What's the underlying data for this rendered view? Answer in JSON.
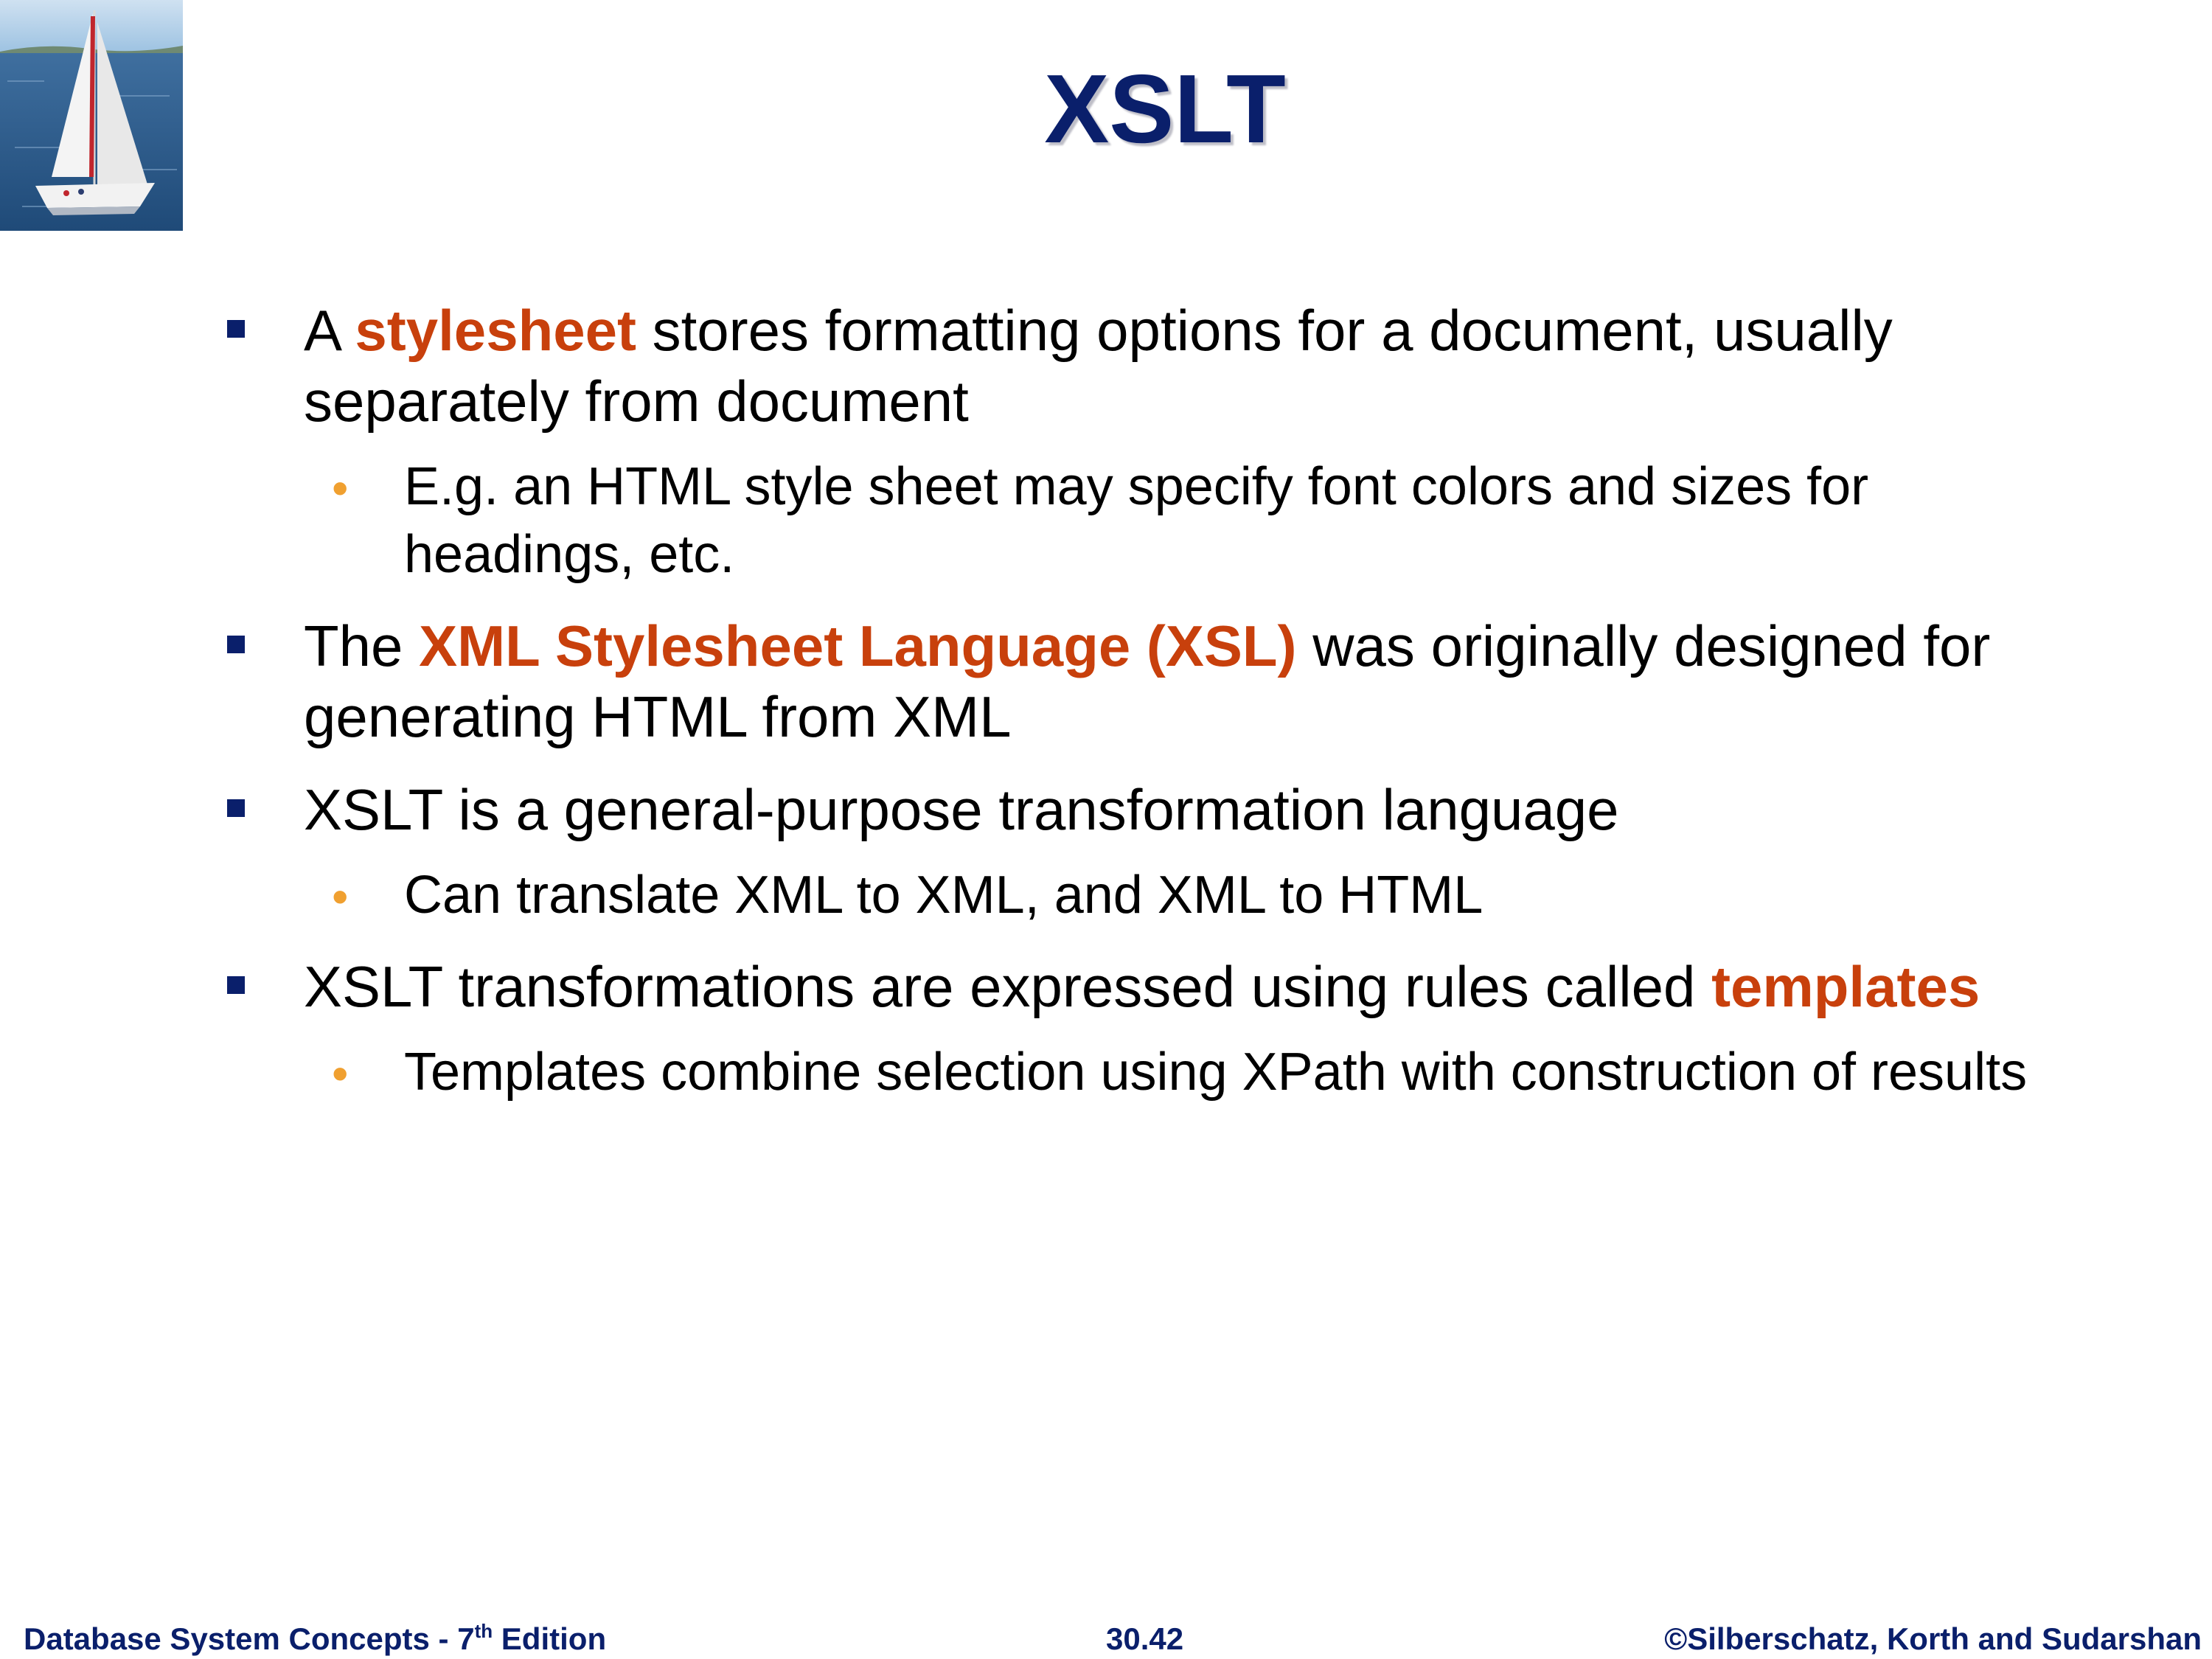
{
  "slide": {
    "title": "XSLT"
  },
  "bullets": [
    {
      "level": 1,
      "parts": [
        {
          "text": "A ",
          "highlight": false
        },
        {
          "text": "stylesheet",
          "highlight": true
        },
        {
          "text": " stores formatting options for a document, usually separately from document",
          "highlight": false
        }
      ]
    },
    {
      "level": 2,
      "parts": [
        {
          "text": "E.g. an HTML style sheet may specify font colors and sizes for headings, etc.",
          "highlight": false
        }
      ]
    },
    {
      "level": 1,
      "parts": [
        {
          "text": "The ",
          "highlight": false
        },
        {
          "text": "XML Stylesheet Language (XSL)",
          "highlight": true
        },
        {
          "text": " was originally designed for generating HTML from XML",
          "highlight": false
        }
      ]
    },
    {
      "level": 1,
      "parts": [
        {
          "text": "XSLT is a general-purpose transformation language",
          "highlight": false
        }
      ]
    },
    {
      "level": 2,
      "parts": [
        {
          "text": "Can translate XML to XML, and XML to HTML",
          "highlight": false
        }
      ]
    },
    {
      "level": 1,
      "parts": [
        {
          "text": "XSLT transformations are expressed using rules called ",
          "highlight": false
        },
        {
          "text": "templates",
          "highlight": true
        }
      ]
    },
    {
      "level": 2,
      "parts": [
        {
          "text": "Templates combine selection using XPath with construction of results",
          "highlight": false
        }
      ]
    }
  ],
  "footer": {
    "book_title": "Database System Concepts - 7",
    "edition_suffix": "th",
    "edition_label": " Edition",
    "slide_number": "30.42",
    "copyright": "©Silberschatz, Korth and Sudarshan"
  },
  "colors": {
    "title": "#0a1f6b",
    "highlight": "#c8400c",
    "bullet_level1": "#0a1f6b",
    "bullet_level2": "#f0a030"
  },
  "icons": {
    "logo": "sailboat-logo-icon"
  }
}
